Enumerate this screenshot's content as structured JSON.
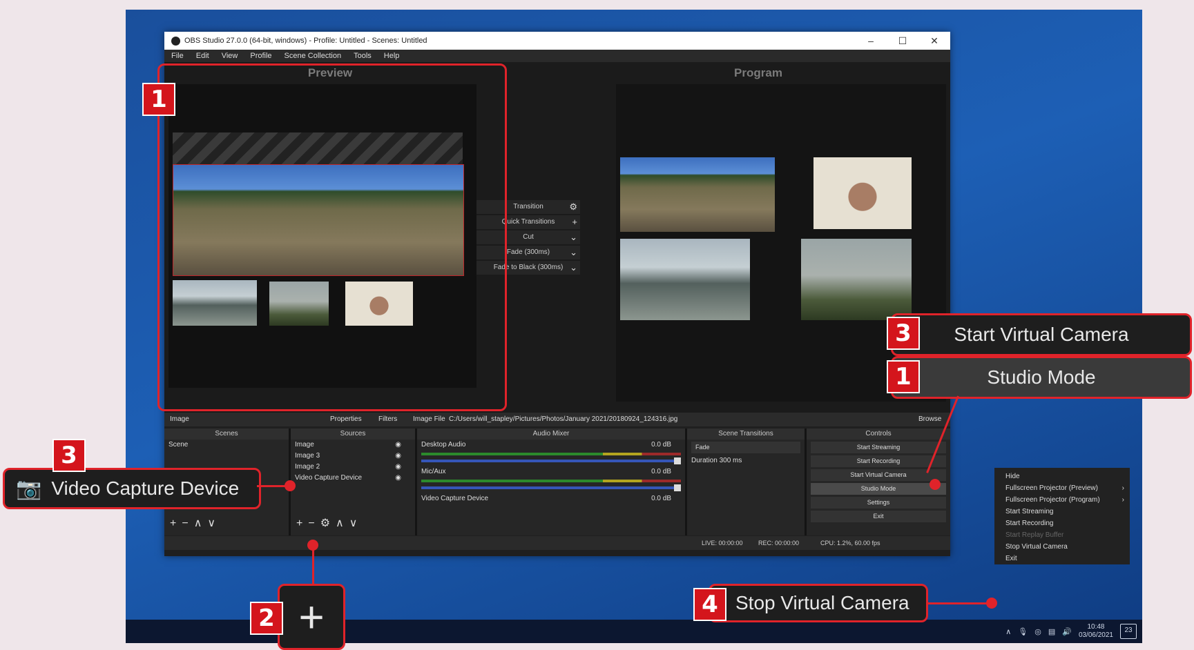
{
  "window": {
    "title": "OBS Studio 27.0.0 (64-bit, windows) - Profile: Untitled - Scenes: Untitled",
    "controls": [
      "–",
      "☐",
      "✕"
    ]
  },
  "menu": [
    "File",
    "Edit",
    "View",
    "Profile",
    "Scene Collection",
    "Tools",
    "Help"
  ],
  "canvas": {
    "preview_label": "Preview",
    "program_label": "Program"
  },
  "transition_panel": {
    "items": [
      "Transition",
      "Quick Transitions",
      "Cut",
      "Fade (300ms)",
      "Fade to Black (300ms)"
    ]
  },
  "props_bar": {
    "source": "Image",
    "properties": "Properties",
    "filters": "Filters",
    "image_file_label": "Image File",
    "path": "C:/Users/will_stapley/Pictures/Photos/January 2021/20180924_124316.jpg",
    "browse": "Browse"
  },
  "docks": {
    "scenes": {
      "title": "Scenes",
      "items": [
        "Scene"
      ]
    },
    "sources": {
      "title": "Sources",
      "items": [
        "Image",
        "Image 3",
        "Image 2",
        "Video Capture Device"
      ]
    },
    "audio": {
      "title": "Audio Mixer",
      "channels": [
        {
          "name": "Desktop Audio",
          "db": "0.0 dB"
        },
        {
          "name": "Mic/Aux",
          "db": "0.0 dB"
        },
        {
          "name": "Video Capture Device",
          "db": "0.0 dB"
        }
      ]
    },
    "transitions": {
      "title": "Scene Transitions",
      "type": "Fade",
      "duration_label": "Duration",
      "duration": "300 ms"
    },
    "controls": {
      "title": "Controls",
      "buttons": [
        "Start Streaming",
        "Start Recording",
        "Start Virtual Camera",
        "Studio Mode",
        "Settings",
        "Exit"
      ]
    }
  },
  "status": {
    "live": "LIVE: 00:00:00",
    "rec": "REC: 00:00:00",
    "cpu": "CPU: 1.2%, 60.00 fps"
  },
  "tray_menu": {
    "items": [
      "Hide",
      "Fullscreen Projector (Preview)",
      "Fullscreen Projector (Program)",
      "Start Streaming",
      "Start Recording",
      "Start Replay Buffer",
      "Stop Virtual Camera",
      "Exit"
    ]
  },
  "taskbar": {
    "time": "10:48",
    "date": "03/06/2021",
    "notifications": "23"
  },
  "annotations": {
    "badge1": "1",
    "badge2": "2",
    "badge3": "3",
    "badge4": "4",
    "callout_video_capture": "Video Capture Device",
    "callout_start_vc": "Start Virtual Camera",
    "callout_studio_mode": "Studio Mode",
    "callout_stop_vc": "Stop Virtual Camera",
    "plus": "+"
  },
  "colors": {
    "accent_red": "#e0232a",
    "badge_red": "#d4151c",
    "desktop_blue": "#1d5fb5"
  }
}
